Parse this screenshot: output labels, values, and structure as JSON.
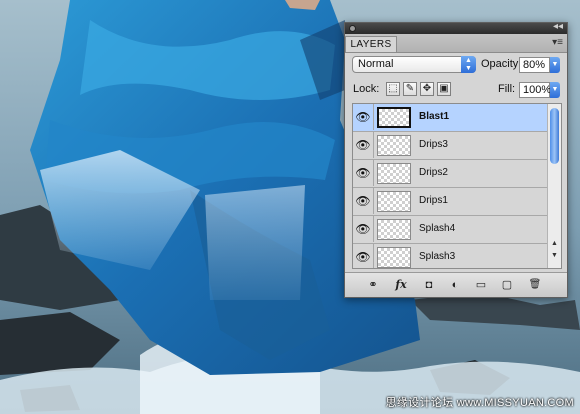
{
  "watermark": "思缘设计论坛 www.MISSYUAN.COM",
  "panel": {
    "title_tab": "LAYERS",
    "collapse_glyph": "◂◂",
    "menu_glyph": "▾≡",
    "blend_mode": "Normal",
    "opacity_label": "Opacity:",
    "opacity_value": "80%",
    "lock_label": "Lock:",
    "fill_label": "Fill:",
    "fill_value": "100%",
    "lock_icons": [
      "lock-transparent-icon",
      "lock-brush-icon",
      "lock-move-icon",
      "lock-all-icon"
    ],
    "layers": [
      {
        "name": "Blast1",
        "selected": true,
        "visible": true
      },
      {
        "name": "Drips3",
        "selected": false,
        "visible": true
      },
      {
        "name": "Drips2",
        "selected": false,
        "visible": true
      },
      {
        "name": "Drips1",
        "selected": false,
        "visible": true
      },
      {
        "name": "Splash4",
        "selected": false,
        "visible": true
      },
      {
        "name": "Splash3",
        "selected": false,
        "visible": true
      }
    ],
    "footer_icons": [
      "link-icon",
      "fx-icon",
      "mask-icon",
      "adjustment-icon",
      "group-folder-icon",
      "new-layer-icon",
      "trash-icon"
    ],
    "footer_glyphs": {
      "link": "⚭",
      "fx": "fx",
      "mask": "◘",
      "adjust": "◐",
      "folder": "▭",
      "new": "▢",
      "trash": "🗑"
    },
    "eye_glyph": "👁"
  }
}
